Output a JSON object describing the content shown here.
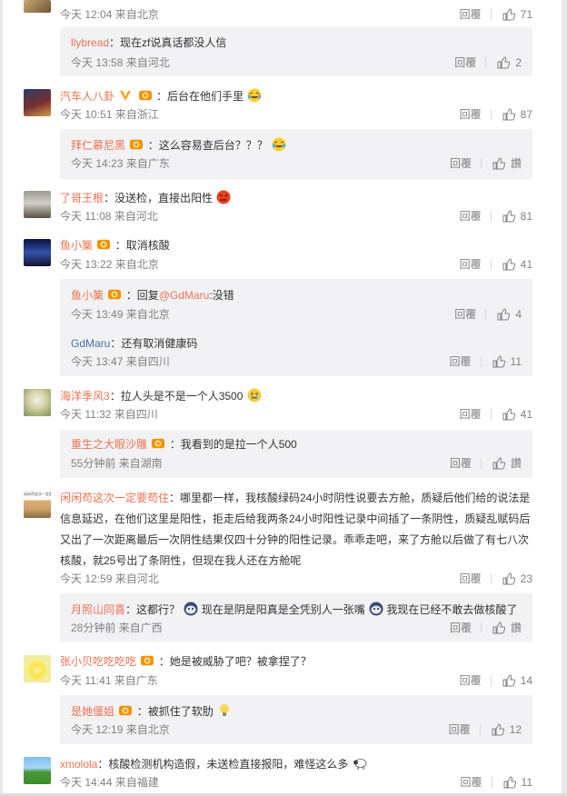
{
  "comments": [
    {
      "id": "c1",
      "meta": "今天 12:04 来自北京",
      "reply": "回覆",
      "likes": "71"
    },
    {
      "id": "r1",
      "user": "llybread",
      "text": "：现在zf说真话都没人信",
      "meta": "今天 13:58 来自河北",
      "reply": "回覆",
      "likes": "2"
    },
    {
      "id": "c2",
      "user": "汽车人八卦",
      "text": "：后台在他们手里",
      "meta": "今天 10:51 来自浙江",
      "reply": "回覆",
      "likes": "87"
    },
    {
      "id": "r2",
      "user": "拜仁慕尼黑",
      "text": "：这么容易查后台？？？",
      "meta": "今天 14:23 来自广东",
      "reply": "回覆",
      "likes": "讚"
    },
    {
      "id": "c3",
      "user": "了哥王根",
      "text": "：没送检，直接出阳性",
      "meta": "今天 11:08 来自河北",
      "reply": "回覆",
      "likes": "81"
    },
    {
      "id": "c4",
      "user": "鱼小篥",
      "text": "：取消核酸",
      "meta": "今天 13:22 来自北京",
      "reply": "回覆",
      "likes": "41"
    },
    {
      "id": "r3",
      "user": "鱼小篥",
      "text_prefix": "：回复",
      "mention": "@GdMaru",
      "text_suffix": ":没错",
      "meta": "今天 13:49 来自北京",
      "reply": "回覆",
      "likes": "4"
    },
    {
      "id": "r4",
      "user": "GdMaru",
      "text": "：还有取消健康码",
      "meta": "今天 13:47 来自四川",
      "reply": "回覆",
      "likes": "11"
    },
    {
      "id": "c5",
      "user": "海洋季风3",
      "text": "：拉人头是不是一个人3500",
      "meta": "今天 11:32 来自四川",
      "reply": "回覆",
      "likes": "41"
    },
    {
      "id": "r5",
      "user": "重生之大眼沙雕",
      "text": "：我看到的是拉一个人500",
      "meta": "55分钟前 来自湖南",
      "reply": "回覆",
      "likes": "讚"
    },
    {
      "id": "c6",
      "user": "闲闲苟这次一定要苟住",
      "line1": "：哪里都一样，我核酸绿码24小时阴性说要去方舱，质疑后他们给的说法是",
      "line2": "信息延迟，在他们这里是阳性，拒走后给我两条24小时阳性记录中间插了一条阴性，质疑乱赋码后",
      "line3": "又出了一次距离最后一次阴性结果仅四十分钟的阳性记录。乖乖走吧，来了方舱以后做了有七八次",
      "line4": "核酸，就25号出了条阴性，但现在我人还在方舱呢",
      "meta": "今天 12:59 来自河北",
      "reply": "回覆",
      "likes": "23"
    },
    {
      "id": "r6",
      "user": "月照山同喜",
      "text1": "：这都行？",
      "text2": "现在是阴是阳真是全凭别人一张嘴",
      "text3": "我现在已经不敢去做核酸了",
      "meta": "28分钟前 来自广西",
      "reply": "回覆",
      "likes": "讚"
    },
    {
      "id": "c7",
      "user": "张小贝吃吃吃吃",
      "text": "：她是被威胁了吧？被拿捏了？",
      "meta": "今天 11:41 来自广东",
      "reply": "回覆",
      "likes": "14"
    },
    {
      "id": "r7",
      "user": "是她僵姐",
      "text": "：被抓住了软肋",
      "meta": "今天 12:19 来自北京",
      "reply": "回覆",
      "likes": "12"
    },
    {
      "id": "c8",
      "user": "xmolola",
      "text": "：核酸检测机构造假，未送检直接报阳，难怪这么多",
      "meta": "今天 14:44 来自福建",
      "reply": "回覆",
      "likes": "11"
    }
  ],
  "avatar_texts": {
    "c6": "闲闲苟这次一定要苟住"
  },
  "colors": {
    "username": "#eb7350",
    "link": "#4170a8",
    "meta": "#808080",
    "reply_bg": "#f2f2f5"
  }
}
